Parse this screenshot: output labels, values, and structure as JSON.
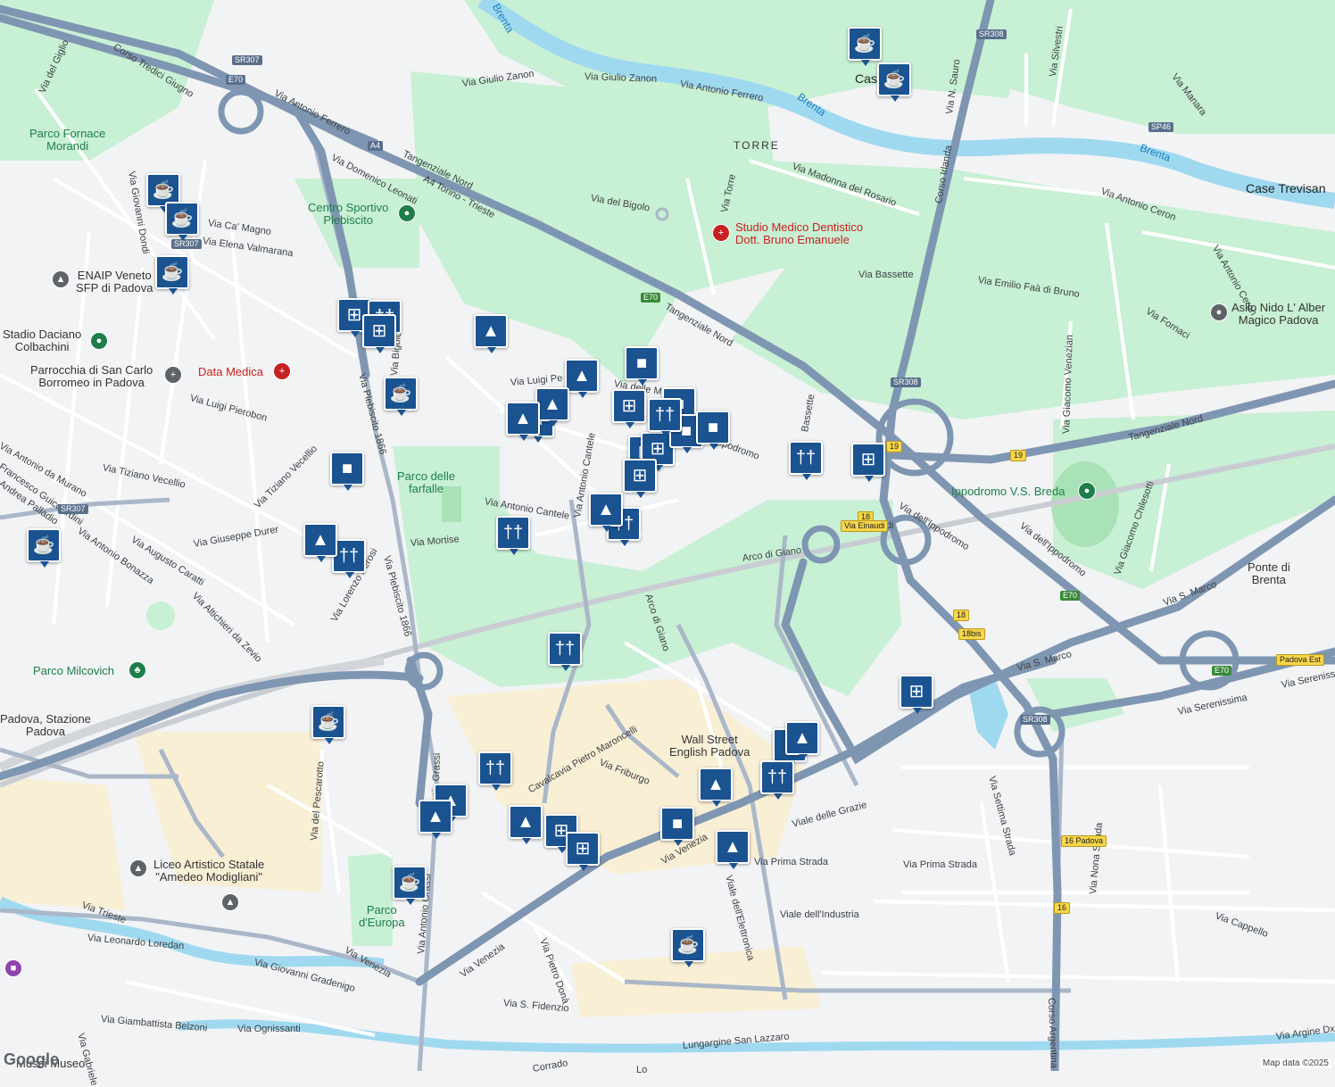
{
  "map": {
    "credit": "Map data ©2025",
    "logo": "Google",
    "water_labels": [
      "Brenta",
      "Brenta",
      "Brenta"
    ],
    "area_labels": [
      "TORRE",
      "Case Trevisan",
      "Ponte di\nBrenta",
      "Caselle"
    ],
    "park_labels": [
      "Parco Fornace\nMorandi",
      "Centro Sportivo\nPlebiscito",
      "Parco delle\nfarfalle",
      "Parco Milcovich",
      "Ippodromo V.S. Breda",
      "Parco\nd'Europa"
    ],
    "poi_labels": [
      "ENAIP Veneto\nSFP di Padova",
      "Stadio Daciano\nColbachini",
      "Parrocchia di San Carlo\nBorromeo in Padova",
      "Liceo Artistico Statale\n\"Amedeo Modigliani\"",
      "Wall Street\nEnglish Padova",
      "Asilo Nido L' Alber\nMagico Padova",
      "Padova, Stazione\nPadova",
      "Musei Museo"
    ],
    "medical_labels": [
      "Studio Medico Dentistico\nDott. Bruno Emanuele",
      "Data Medica"
    ],
    "road_labels": [
      "Corso Tredici Giugno",
      "Via Antonio Ferrero",
      "Via Giulio Zanon",
      "Via Giulio Zanon",
      "Via Antonio Ferrero",
      "Tangenziale Nord",
      "A4 Torino - Trieste",
      "Via Domenico Leonati",
      "Via del Bigolo",
      "Via Madonna del Rosario",
      "Via Torre",
      "Tangenziale Nord",
      "Via Bassette",
      "Via Emilio Faà di Bruno",
      "Via Fornaci",
      "Corso Irlanda",
      "Via N. Sauro",
      "Via Silvestri",
      "Via Manara",
      "Via Antonio Ceron",
      "Via Antonio Ceron",
      "Via Giacomo Venezian",
      "Tangenziale Nord",
      "Via dell'Ippodromo",
      "Via dell'Ippodromo",
      "Via Giacomo Chilesotti",
      "Via S. Marco",
      "Via S. Marco",
      "Via Serenissima",
      "Via Serenissima",
      "Via Ca' Magno",
      "Via Elena Valmarana",
      "Via Giovanni Dondi",
      "Via del Giglio",
      "Via Luigi Pierobon",
      "Via Tiziano Vecellio",
      "Via Tiziano Vecellio",
      "Via Antonio da Murano",
      "Francesco Guicciardini",
      "Andrea Palladio",
      "Via Antonio Bonazza",
      "Via Augusto Caratti",
      "Via Giuseppe Durer",
      "Via Altichieri da Zevio",
      "Via Lorenzo Perosi",
      "Via Mortise",
      "Via Antonio Cantele",
      "Via Antonio Cantele",
      "Via Luigi Pe",
      "Via delle M",
      "Ippodromo",
      "Via Plebiscito 1866",
      "Via Plebiscito 1866",
      "Via Bigolo",
      "Arco di Giano",
      "Arco di Giano",
      "Via Einaudi",
      "Via Antonio Grassi",
      "Via Antonio Grassi",
      "Cavalcavia Pietro Maroncelli",
      "Via Friburgo",
      "Via del Pescarotto",
      "Via Venezia",
      "Via Venezia",
      "Via Venezia",
      "Viale delle Grazie",
      "Via Prima Strada",
      "Via Prima Strada",
      "Viale dell'Elettronica",
      "Viale dell'Industria",
      "Via Settima Strada",
      "Via Nona Strada",
      "Via Cappello",
      "Corso Argentina",
      "Via Pietro Donà",
      "Via S. Fidenzio",
      "Via Trieste",
      "Via Leonardo Loredan",
      "Via Giovanni Gradenigo",
      "Via Giambattista Belzoni",
      "Via Ognissanti",
      "Via Gabriele",
      "Lungargine San Lazzaro",
      "Via Argine Dx",
      "Corrado",
      "Lo",
      "Bassette"
    ],
    "shields": [
      "SR307",
      "E70",
      "A4",
      "SR307",
      "E70",
      "SR308",
      "SR308",
      "SP46",
      "19",
      "19",
      "18",
      "18",
      "18bis",
      "SR308",
      "E70",
      "E70",
      "16",
      "16 Padova",
      "SR307",
      "Padova Est",
      "Via Einaudi"
    ],
    "markers": {
      "coffee_icon": "cup",
      "cart_icon": "shopping-cart",
      "bag_icon": "shopping-bag",
      "food_icon": "fork-knife",
      "school_icon": "mortarboard"
    },
    "colors": {
      "background": "#f2f3f5",
      "park": "#c8f0d4",
      "water": "#9fd9f0",
      "highway": "#7f96b2",
      "marker": "#1a5390",
      "industrial": "#f9efd5"
    }
  }
}
